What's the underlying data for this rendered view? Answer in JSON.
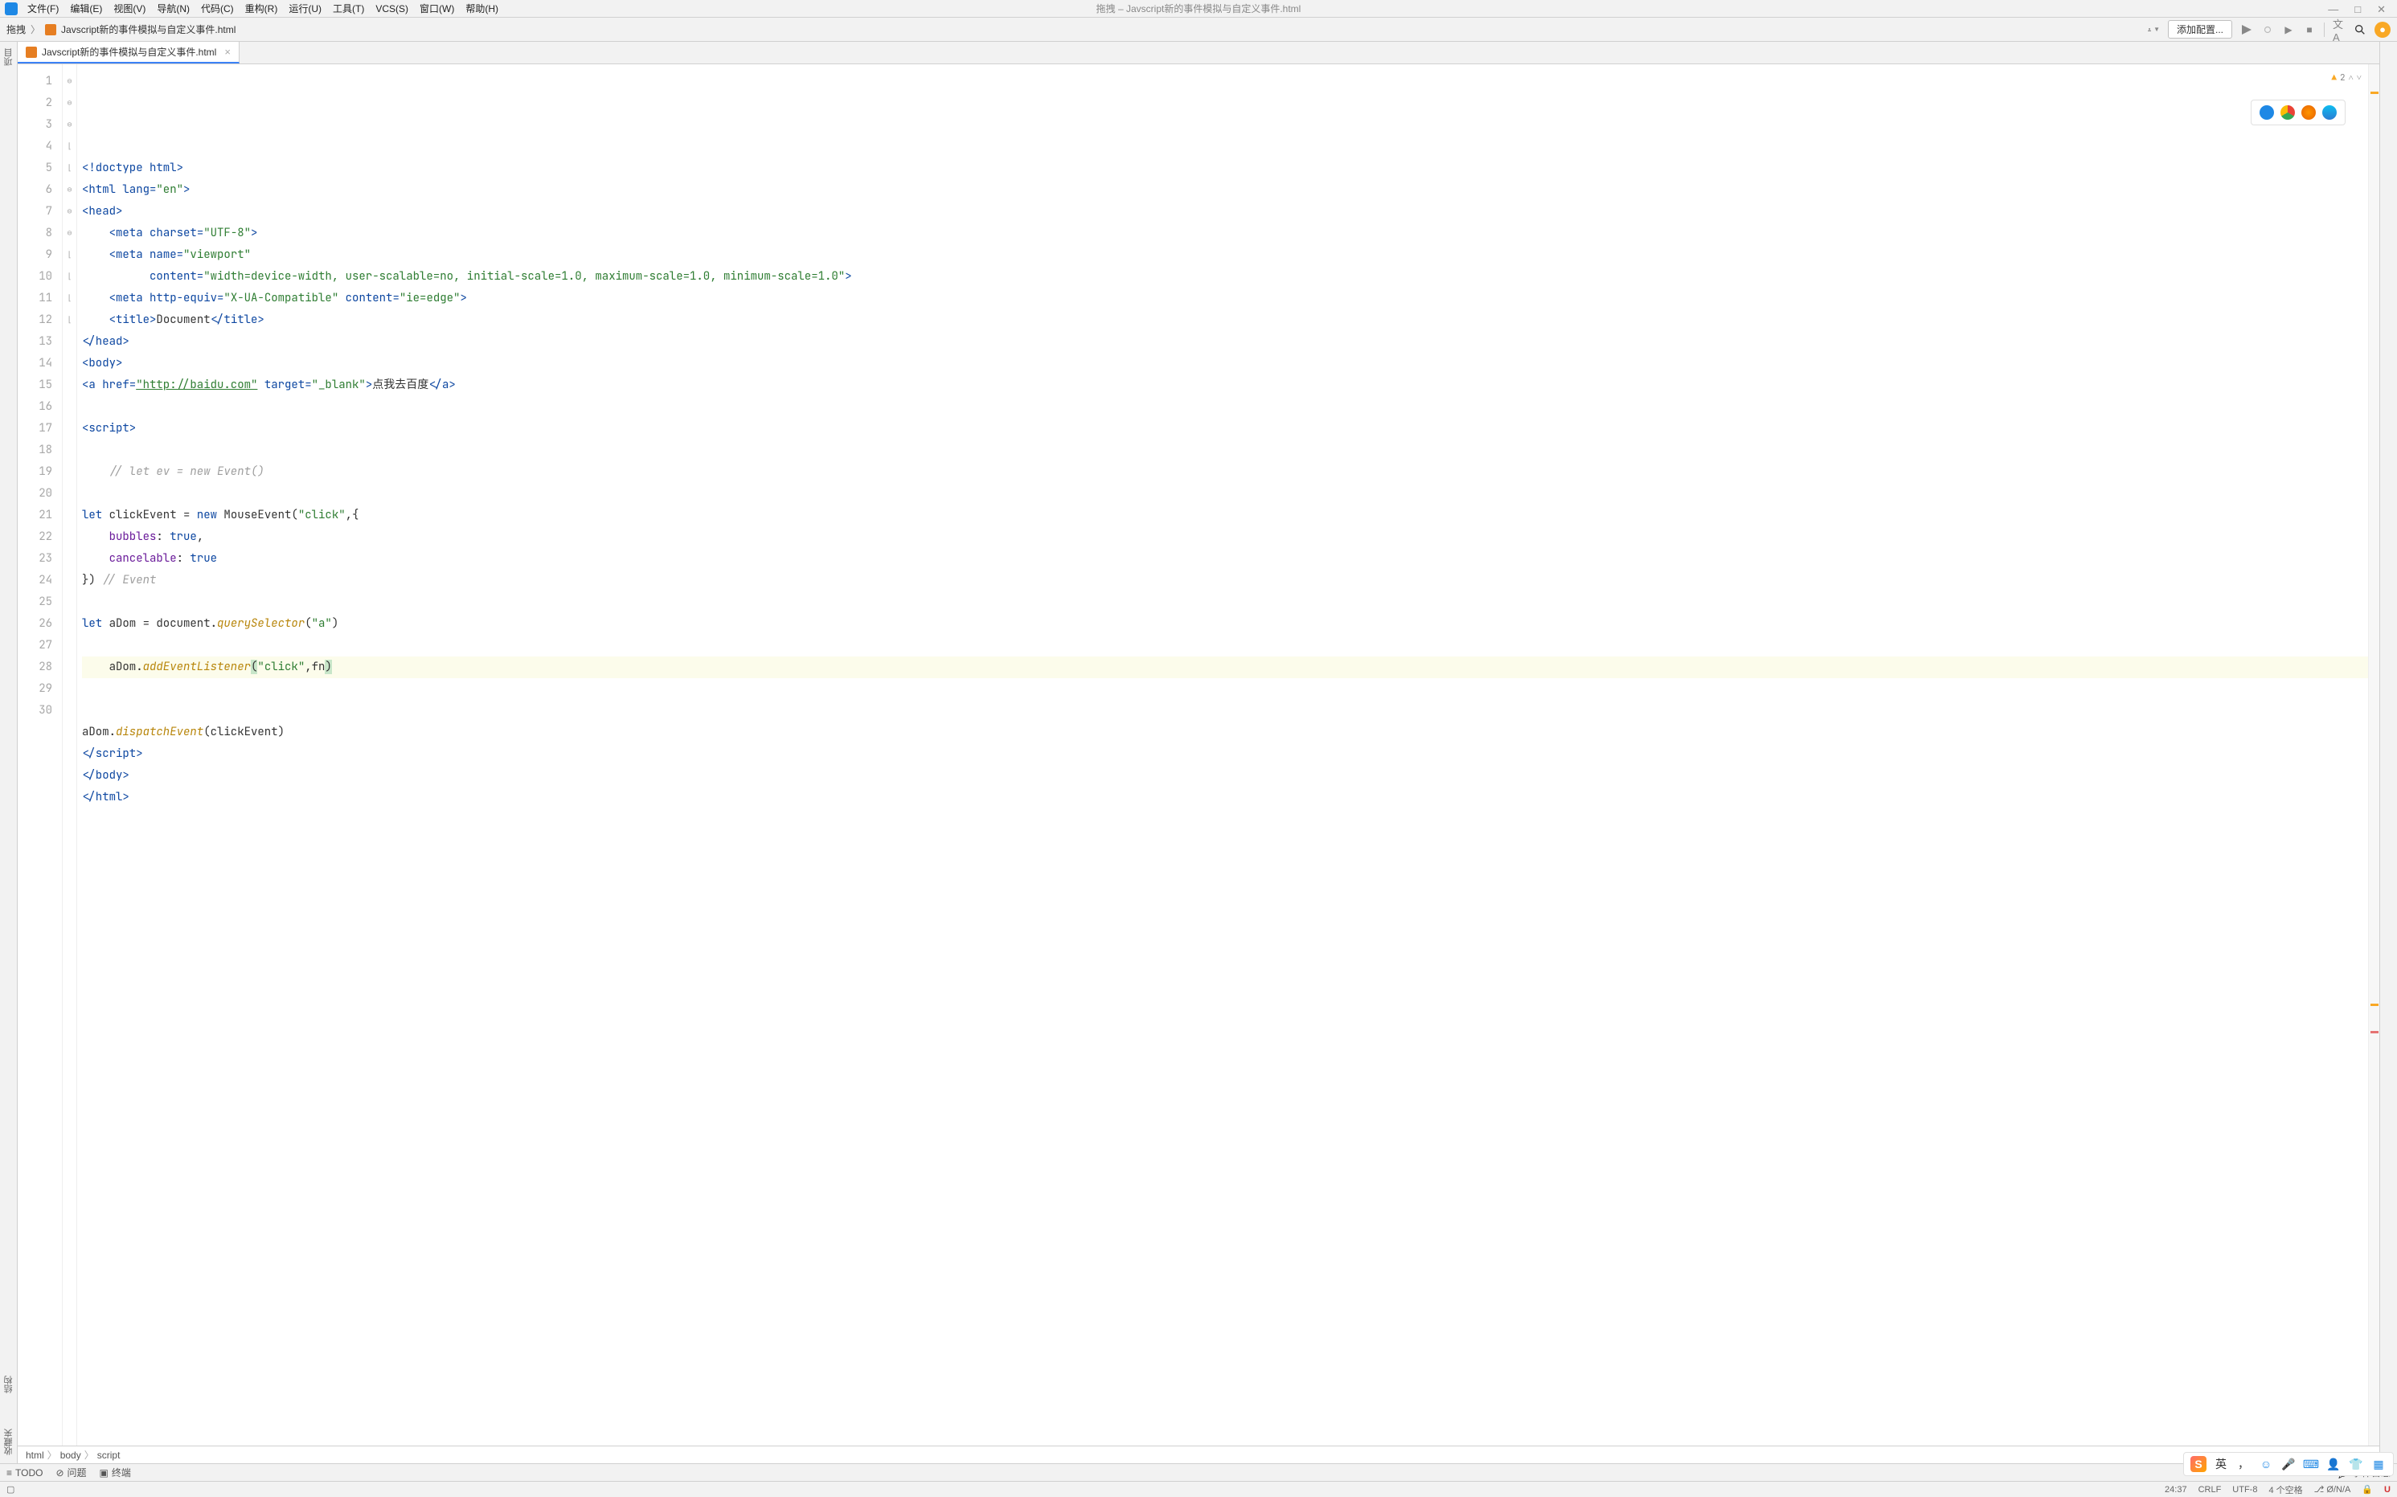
{
  "window": {
    "doc_title": "拖拽 – Javscript新的事件模拟与自定义事件.html"
  },
  "menu": {
    "items": [
      "文件(F)",
      "编辑(E)",
      "视图(V)",
      "导航(N)",
      "代码(C)",
      "重构(R)",
      "运行(U)",
      "工具(T)",
      "VCS(S)",
      "窗口(W)",
      "帮助(H)"
    ]
  },
  "titlebar_buttons": {
    "min": "—",
    "max": "□",
    "close": "✕"
  },
  "nav": {
    "project": "拖拽",
    "file": "Javscript新的事件模拟与自定义事件.html"
  },
  "toolbar": {
    "add_config": "添加配置...",
    "translate": "文A"
  },
  "left_labels": {
    "project": "项目",
    "structure": "结构",
    "favorites": "收藏夹"
  },
  "tab": {
    "label": "Javscript新的事件模拟与自定义事件.html"
  },
  "inspection": {
    "warn_count": "2"
  },
  "code": {
    "lines": [
      {
        "n": 1,
        "html": "<span class='tok-tag'>&lt;!doctype </span><span class='tok-attr'>html</span><span class='tok-tag'>&gt;</span>"
      },
      {
        "n": 2,
        "html": "<span class='tok-tag'>&lt;html </span><span class='tok-attr'>lang=</span><span class='tok-str'>\"en\"</span><span class='tok-tag'>&gt;</span>"
      },
      {
        "n": 3,
        "html": "<span class='tok-tag'>&lt;head&gt;</span>"
      },
      {
        "n": 4,
        "html": "    <span class='tok-tag'>&lt;meta </span><span class='tok-attr'>charset=</span><span class='tok-str'>\"UTF-8\"</span><span class='tok-tag'>&gt;</span>"
      },
      {
        "n": 5,
        "html": "    <span class='tok-tag'>&lt;meta </span><span class='tok-attr'>name=</span><span class='tok-str'>\"viewport\"</span>"
      },
      {
        "n": 6,
        "html": "          <span class='tok-attr'>content=</span><span class='tok-str'>\"width=device-width, user-scalable=no, initial-scale=1.0, maximum-scale=1.0, minimum-scale=1.0\"</span><span class='tok-tag'>&gt;</span>"
      },
      {
        "n": 7,
        "html": "    <span class='tok-tag'>&lt;meta </span><span class='tok-attr'>http-equiv=</span><span class='tok-str'>\"X-UA-Compatible\"</span> <span class='tok-attr'>content=</span><span class='tok-str'>\"ie=edge\"</span><span class='tok-tag'>&gt;</span>"
      },
      {
        "n": 8,
        "html": "    <span class='tok-tag'>&lt;title&gt;</span>Document<span class='tok-tag'>&lt;/title&gt;</span>"
      },
      {
        "n": 9,
        "html": "<span class='tok-tag'>&lt;/head&gt;</span>"
      },
      {
        "n": 10,
        "html": "<span class='tok-tag'>&lt;body&gt;</span>"
      },
      {
        "n": 11,
        "html": "<span class='tok-tag'>&lt;a </span><span class='tok-attr'>href=</span><span class='tok-str-link'>\"http://baidu.com\"</span> <span class='tok-attr'>target=</span><span class='tok-str'>\"_blank\"</span><span class='tok-tag'>&gt;</span>点我去百度<span class='tok-tag'>&lt;/a&gt;</span>"
      },
      {
        "n": 12,
        "html": ""
      },
      {
        "n": 13,
        "html": "<span class='tok-tag'>&lt;script&gt;</span>"
      },
      {
        "n": 14,
        "html": ""
      },
      {
        "n": 15,
        "html": "    <span class='tok-comment'>// let ev = new Event()</span>"
      },
      {
        "n": 16,
        "html": ""
      },
      {
        "n": 17,
        "html": "<span class='tok-kw'>let</span> <span class='tok-plain'>clickEvent</span> = <span class='tok-kw'>new</span> MouseEvent(<span class='tok-str'>\"click\"</span>,{"
      },
      {
        "n": 18,
        "html": "    <span class='tok-prop'>bubbles</span>: <span class='tok-kw'>true</span>,"
      },
      {
        "n": 19,
        "html": "    <span class='tok-prop'>cancelable</span>: <span class='tok-kw'>true</span>"
      },
      {
        "n": 20,
        "html": "}) <span class='tok-comment'>// Event</span>"
      },
      {
        "n": 21,
        "html": ""
      },
      {
        "n": 22,
        "html": "<span class='tok-kw'>let</span> aDom = document.<span class='tok-prop2'>querySelector</span>(<span class='tok-str'>\"a\"</span>)"
      },
      {
        "n": 23,
        "html": ""
      },
      {
        "n": 24,
        "current": true,
        "html": "    aDom.<span class='tok-prop2'>addEventListener</span><span class='hl-bracket'>(</span><span class='tok-str'>\"click\"</span>,fn<span class='hl-bracket'>)</span>"
      },
      {
        "n": 25,
        "html": ""
      },
      {
        "n": 26,
        "html": ""
      },
      {
        "n": 27,
        "html": "aDom.<span class='tok-prop2'>dispatchEvent</span>(clickEvent)"
      },
      {
        "n": 28,
        "html": "<span class='tok-tag'>&lt;/script&gt;</span>"
      },
      {
        "n": 29,
        "html": "<span class='tok-tag'>&lt;/body&gt;</span>"
      },
      {
        "n": 30,
        "html": "<span class='tok-tag'>&lt;/html&gt;</span>"
      }
    ]
  },
  "breadcrumb": {
    "path": [
      "html",
      "body",
      "script"
    ]
  },
  "bottom_tools": {
    "todo": "TODO",
    "problems": "问题",
    "terminal": "终端",
    "event_log": "事件日志"
  },
  "status": {
    "pos": "24:37",
    "eol": "CRLF",
    "enc": "UTF-8",
    "indent": "4 个空格",
    "branch": "Ø/N/A",
    "lock": "🔒"
  },
  "ime": {
    "logo": "S",
    "lang": "英",
    "comma": "，"
  }
}
